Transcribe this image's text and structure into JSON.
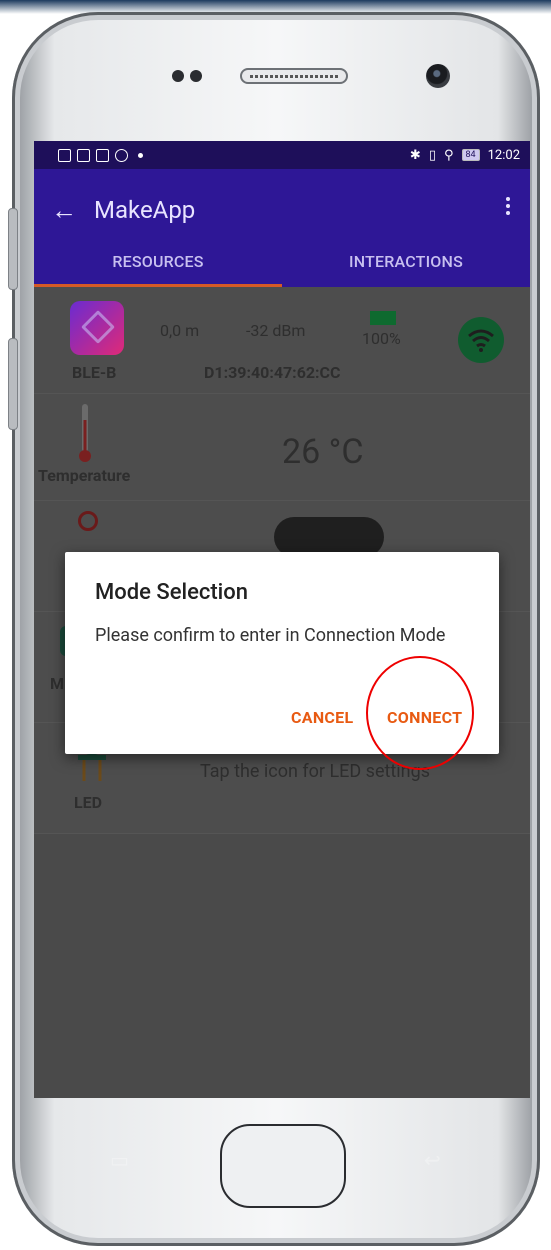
{
  "status_bar": {
    "time": "12:02",
    "battery": "84"
  },
  "app_bar": {
    "title": "MakeApp"
  },
  "tabs": [
    {
      "label": "RESOURCES",
      "active": true
    },
    {
      "label": "INTERACTIONS",
      "active": false
    }
  ],
  "device": {
    "name": "BLE-B",
    "distance": "0,0 m",
    "rssi": "-32 dBm",
    "battery": "100%",
    "mac": "D1:39:40:47:62:CC"
  },
  "temperature": {
    "label": "Temperature",
    "value": "26 °C"
  },
  "row4": {
    "label_partial": "M"
  },
  "led": {
    "label": "LED",
    "hint": "Tap the icon for LED settings"
  },
  "dialog": {
    "title": "Mode Selection",
    "message": "Please confirm to enter in Connection Mode",
    "cancel": "CANCEL",
    "confirm": "CONNECT"
  },
  "colors": {
    "primary": "#2e1796",
    "status_bar": "#1e0f5a",
    "accent": "#e85a12",
    "tab_indicator": "#d65a25",
    "highlight_circle": "#e00000"
  }
}
